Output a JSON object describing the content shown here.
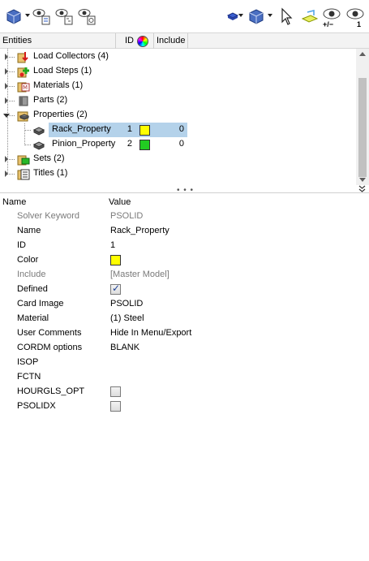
{
  "toolbar": {
    "left_icons": [
      "view-cube-icon",
      "eye-list-icon",
      "eye-tree-icon",
      "eye-filter-icon"
    ],
    "right_icons": [
      "display-box-icon",
      "display-cube-icon",
      "select-cursor-icon",
      "isolate-icon",
      "show-hide-icon",
      "isolate-one-icon"
    ],
    "show_hide_label": "+/−",
    "isolate_one_label": "1"
  },
  "tree_header": {
    "entities": "Entities",
    "id": "ID",
    "color_icon": "color-wheel-icon",
    "include": "Include"
  },
  "tree": {
    "items": [
      {
        "label": "Load Collectors (4)",
        "icon": "load-collector-icon",
        "expanded": false
      },
      {
        "label": "Load Steps (1)",
        "icon": "load-step-icon",
        "expanded": false
      },
      {
        "label": "Materials (1)",
        "icon": "material-icon",
        "expanded": false
      },
      {
        "label": "Parts (2)",
        "icon": "part-icon",
        "expanded": false
      },
      {
        "label": "Properties (2)",
        "icon": "property-folder-icon",
        "expanded": true
      },
      {
        "label": "Rack_Property",
        "icon": "property-icon",
        "id": "1",
        "color": "#ffff00",
        "include": "0",
        "selected": true
      },
      {
        "label": "Pinion_Property",
        "icon": "property-icon",
        "id": "2",
        "color": "#22cc22",
        "include": "0",
        "selected": false
      },
      {
        "label": "Sets (2)",
        "icon": "set-icon",
        "expanded": false
      },
      {
        "label": "Titles (1)",
        "icon": "title-icon",
        "expanded": false
      }
    ]
  },
  "splitter": {
    "dots": "• • •",
    "chevron": "≫"
  },
  "props_header": {
    "name": "Name",
    "value": "Value"
  },
  "props": [
    {
      "name": "Solver Keyword",
      "value": "PSOLID",
      "muted": true
    },
    {
      "name": "Name",
      "value": "Rack_Property"
    },
    {
      "name": "ID",
      "value": "1"
    },
    {
      "name": "Color",
      "swatch": "#ffff00"
    },
    {
      "name": "Include",
      "value": "[Master Model]",
      "muted": true
    },
    {
      "name": "Defined",
      "checkbox": true
    },
    {
      "name": "Card Image",
      "value": "PSOLID"
    },
    {
      "name": "Material",
      "value": "(1) Steel"
    },
    {
      "name": "User Comments",
      "value": "Hide In Menu/Export"
    },
    {
      "name": "CORDM options",
      "value": "BLANK"
    },
    {
      "name": "ISOP",
      "value": ""
    },
    {
      "name": "FCTN",
      "value": ""
    },
    {
      "name": "HOURGLS_OPT",
      "checkbox": false
    },
    {
      "name": "PSOLIDX",
      "checkbox": false
    }
  ]
}
